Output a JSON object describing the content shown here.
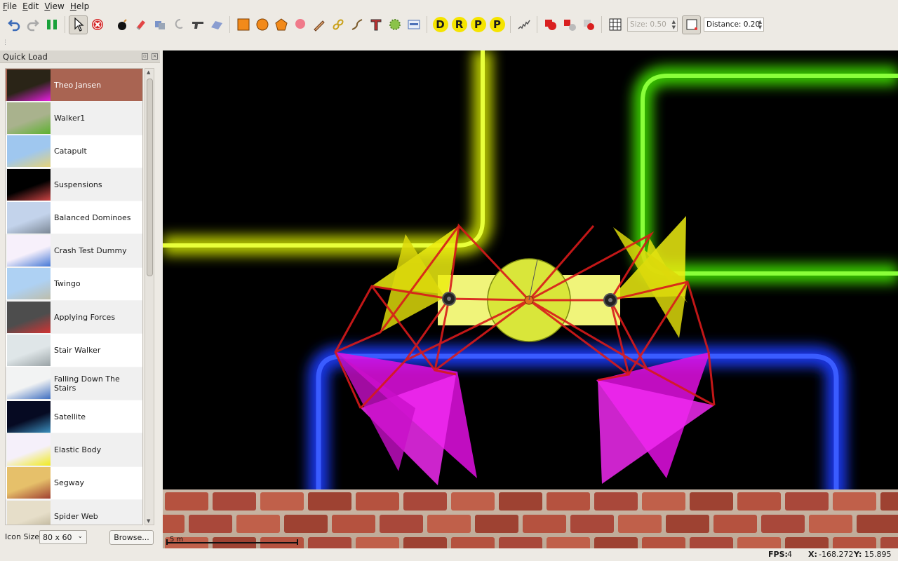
{
  "menu": [
    "File",
    "Edit",
    "View",
    "Help"
  ],
  "toolbar": {
    "letters": [
      "D",
      "R",
      "P",
      "P"
    ],
    "size_field": "Size: 0.50",
    "distance_field": "Distance: 0.20"
  },
  "quick_load": {
    "title": "Quick Load",
    "items": [
      {
        "label": "Theo Jansen",
        "bg": "#2a2417",
        "accent": "#e81ee0"
      },
      {
        "label": "Walker1",
        "bg": "#a9b28d",
        "accent": "#5db12f"
      },
      {
        "label": "Catapult",
        "bg": "#9fc7ef",
        "accent": "#e4d27a"
      },
      {
        "label": "Suspensions",
        "bg": "#000000",
        "accent": "#cc4444"
      },
      {
        "label": "Balanced Dominoes",
        "bg": "#c3d3eb",
        "accent": "#7b8795"
      },
      {
        "label": "Crash Test Dummy",
        "bg": "#f7f0fb",
        "accent": "#4578d6"
      },
      {
        "label": "Twingo",
        "bg": "#aed1f3",
        "accent": "#bdbdab"
      },
      {
        "label": "Applying Forces",
        "bg": "#4d4d4d",
        "accent": "#d33333"
      },
      {
        "label": "Stair Walker",
        "bg": "#dfe6e8",
        "accent": "#9aa3a6"
      },
      {
        "label": "Falling Down The Stairs",
        "bg": "#f2f3f3",
        "accent": "#3f6ec0"
      },
      {
        "label": "Satellite",
        "bg": "#060a22",
        "accent": "#3b8fbf"
      },
      {
        "label": "Elastic Body",
        "bg": "#f5f0fa",
        "accent": "#f0ea20"
      },
      {
        "label": "Segway",
        "bg": "#e6c06a",
        "accent": "#a04030"
      },
      {
        "label": "Spider Web",
        "bg": "#e6dec9",
        "accent": "#b3a98d"
      }
    ],
    "icon_size_label": "Icon Size",
    "icon_size_value": "80 x 60",
    "browse_label": "Browse..."
  },
  "canvas": {
    "scale_label": "5 m"
  },
  "status": {
    "fps_label": "FPS:",
    "fps_value": "4",
    "x_label": "X:",
    "x_value": "-168.272",
    "y_label": "Y:",
    "y_value": "15.895"
  }
}
